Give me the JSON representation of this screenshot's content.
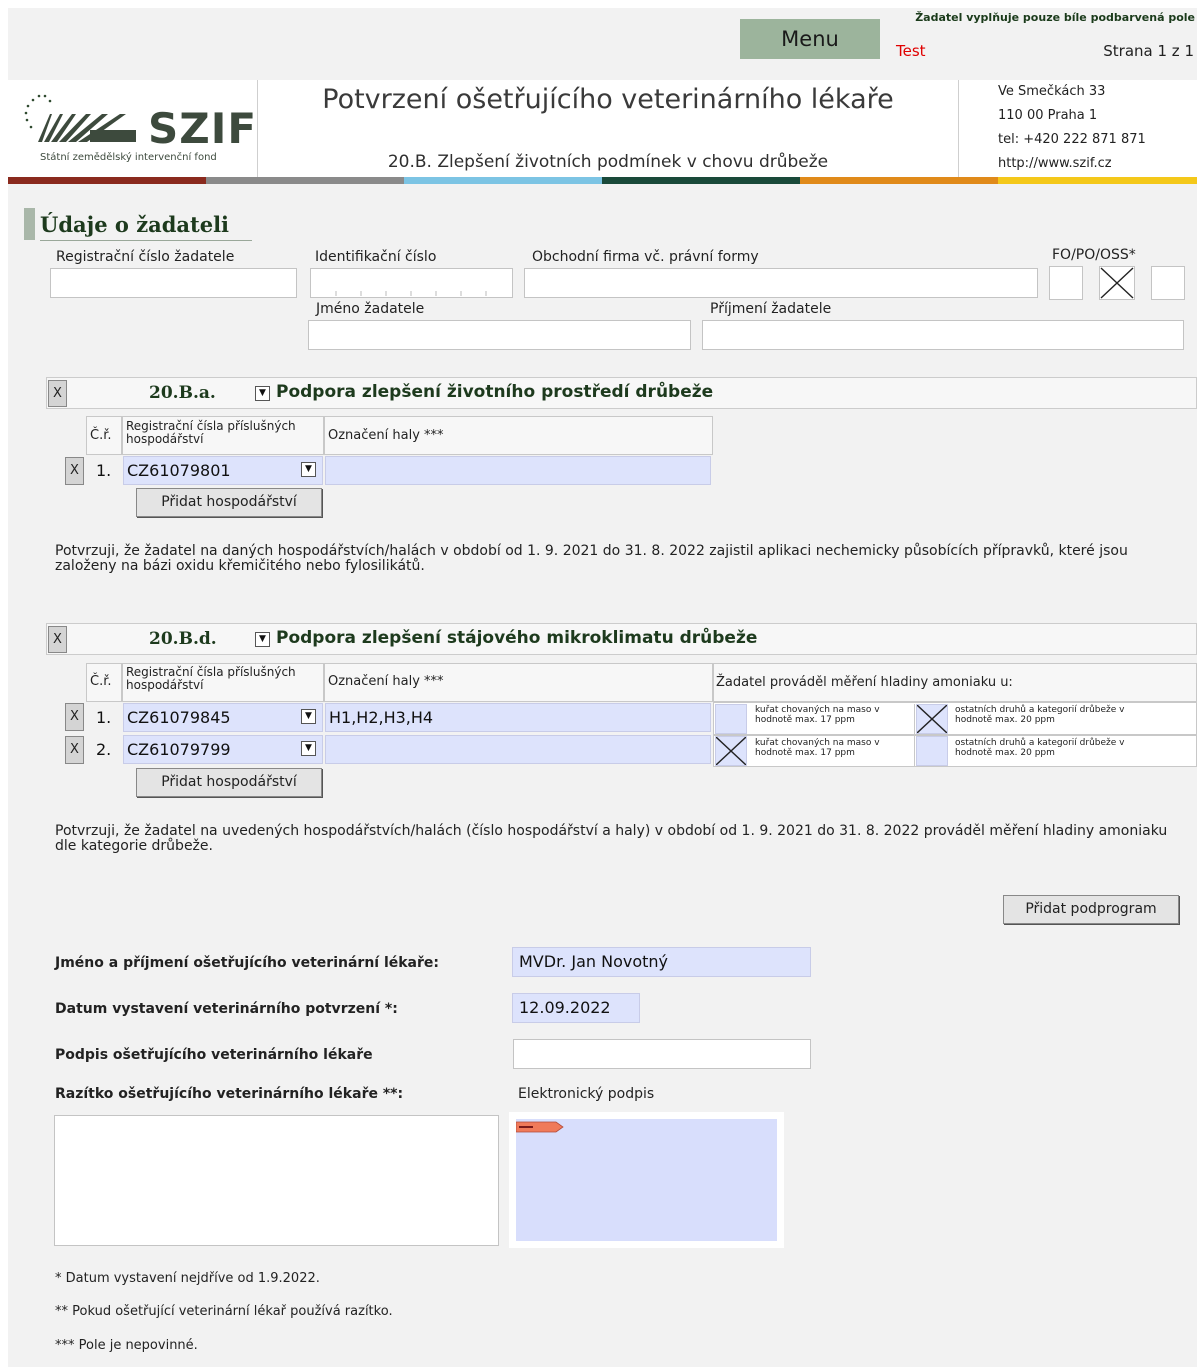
{
  "topbar": {
    "menu_label": "Menu",
    "notice": "Žadatel vyplňuje pouze bíle podbarvená pole",
    "test_label": "Test",
    "page_label": "Strana 1 z 1"
  },
  "header": {
    "logo_text": "SZIF",
    "logo_subtitle": "Státní zemědělský intervenční fond",
    "title": "Potvrzení ošetřujícího veterinárního lékaře",
    "subtitle": "20.B. Zlepšení životních podmínek v chovu drůbeže",
    "address_lines": [
      "Ve Smečkách 33",
      "110 00 Praha 1",
      "tel: +420 222 871 871",
      "http://www.szif.cz"
    ]
  },
  "applicant": {
    "section_title": "Údaje o žadateli",
    "reg_label": "Registrační číslo žadatele",
    "id_label": "Identifikační číslo",
    "firm_label": "Obchodní firma vč. právní formy",
    "type_label": "FO/PO/OSS*",
    "first_name_label": "Jméno žadatele",
    "last_name_label": "Příjmení žadatele"
  },
  "program_a": {
    "x": "X",
    "code": "20.B.a.",
    "title": "Podpora zlepšení životního prostředí drůbeže",
    "col_no": "Č.ř.",
    "col_reg": "Registrační čísla příslušných hospodářství",
    "col_hall": "Označení haly ***",
    "rows": [
      {
        "x": "X",
        "no": "1.",
        "reg": "CZ61079801",
        "hall": ""
      }
    ],
    "add_label": "Přidat hospodářství",
    "statement": "Potvrzuji, že žadatel na daných hospodářstvích/halách v období od 1. 9. 2021 do 31. 8. 2022 zajistil aplikaci nechemicky působících přípravků, které jsou založeny na bázi oxidu křemičitého nebo fylosilikátů."
  },
  "program_d": {
    "x": "X",
    "code": "20.B.d.",
    "title": "Podpora zlepšení stájového mikroklimatu drůbeže",
    "col_no": "Č.ř.",
    "col_reg": "Registrační čísla příslušných hospodářství",
    "col_hall": "Označení haly ***",
    "col_ammonia": "Žadatel prováděl měření hladiny amoniaku u:",
    "opt_broiler": "kuřat chovaných na maso v hodnotě max. 17 ppm",
    "opt_other": "ostatních druhů a kategorií drůbeže v hodnotě max. 20 ppm",
    "rows": [
      {
        "x": "X",
        "no": "1.",
        "reg": "CZ61079845",
        "hall": "H1,H2,H3,H4",
        "broiler": false,
        "other": true
      },
      {
        "x": "X",
        "no": "2.",
        "reg": "CZ61079799",
        "hall": "",
        "broiler": true,
        "other": false
      }
    ],
    "add_label": "Přidat hospodářství",
    "statement": "Potvrzuji, že žadatel na uvedených hospodářstvích/halách (číslo hospodářství a haly) v období od 1. 9. 2021 do 31. 8. 2022 prováděl měření hladiny amoniaku dle kategorie drůbeže."
  },
  "add_subprogram_label": "Přidat podprogram",
  "vet": {
    "name_label": "Jméno a příjmení ošetřujícího veterinární lékaře:",
    "name_value": "MVDr. Jan Novotný",
    "date_label": "Datum vystavení veterinárního potvrzení *:",
    "date_value": "12.09.2022",
    "signature_label": "Podpis ošetřujícího veterinárního lékaře",
    "stamp_label": "Razítko ošetřujícího veterinárního lékaře **:",
    "esign_label": "Elektronický podpis"
  },
  "footnotes": [
    "* Datum vystavení nejdříve od 1.9.2022.",
    "** Pokud ošetřující veterinární lékař používá razítko.",
    "*** Pole je nepovinné."
  ],
  "colors": {
    "accent_green": "#1d3a1d",
    "field_blue": "#dde3fc",
    "test_red": "#e00000",
    "menu_green": "#9cb49c"
  }
}
